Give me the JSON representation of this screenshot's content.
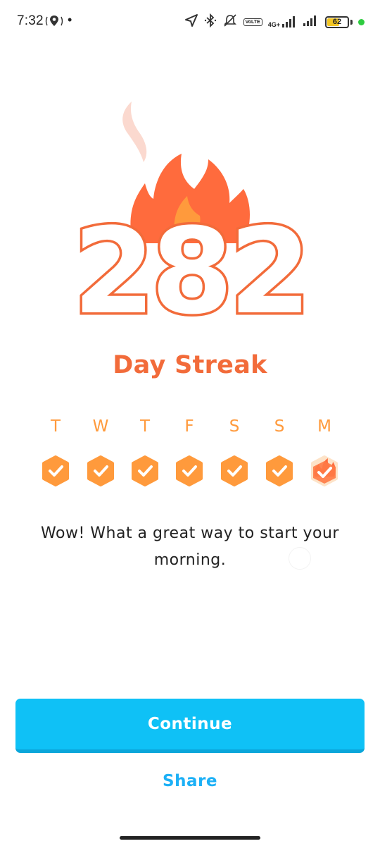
{
  "status_bar": {
    "time": "7:32",
    "battery_level": "62",
    "battery_fraction": 0.62,
    "network": "4G+",
    "lte": "VoLTE"
  },
  "streak": {
    "count": "282",
    "label": "Day Streak"
  },
  "week": {
    "days": [
      {
        "letter": "T",
        "done": true,
        "today": false
      },
      {
        "letter": "W",
        "done": true,
        "today": false
      },
      {
        "letter": "T",
        "done": true,
        "today": false
      },
      {
        "letter": "F",
        "done": true,
        "today": false
      },
      {
        "letter": "S",
        "done": true,
        "today": false
      },
      {
        "letter": "S",
        "done": true,
        "today": false
      },
      {
        "letter": "M",
        "done": true,
        "today": true
      }
    ]
  },
  "message": "Wow! What a great way to start your morning.",
  "actions": {
    "continue_label": "Continue",
    "share_label": "Share"
  },
  "colors": {
    "accent_orange": "#ff9a3c",
    "streak_red": "#f26b3a",
    "button_blue": "#0fc1f6",
    "link_blue": "#1cb0f6"
  }
}
